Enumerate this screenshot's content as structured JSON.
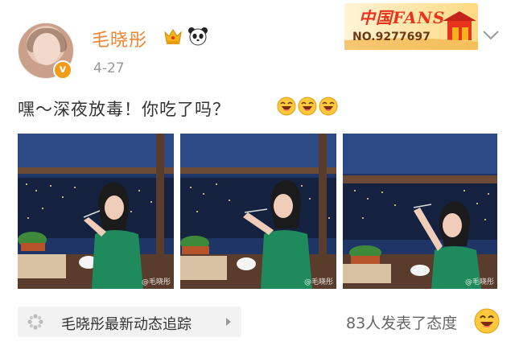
{
  "post": {
    "username": "毛晓彤",
    "date": "4-27",
    "verified_mark": "v",
    "text": "嘿～深夜放毒！你吃了吗？",
    "emojis": [
      "laugh-icon",
      "laugh-icon",
      "laugh-icon"
    ]
  },
  "fans_card": {
    "title": "中国FANS",
    "number": "NO.9277697"
  },
  "images": [
    {
      "watermark": "@毛晓彤"
    },
    {
      "watermark": "@毛晓彤"
    },
    {
      "watermark": "@毛晓彤"
    }
  ],
  "footer": {
    "tracker_label": "毛晓彤最新动态追踪",
    "reactions": "83人发表了态度"
  },
  "colors": {
    "username": "#f28430",
    "date": "#999999",
    "badge": "#f29a1a",
    "fans_red": "#e8331d",
    "sky": "#1e3566",
    "shirt": "#1f8a5c"
  }
}
